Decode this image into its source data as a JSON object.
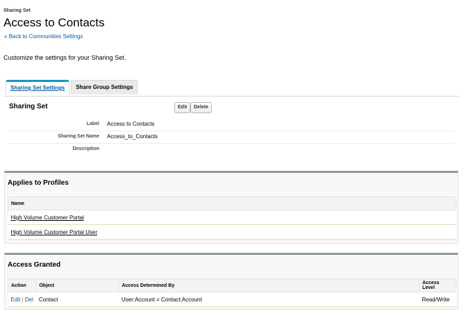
{
  "header": {
    "eyebrow": "Sharing Set",
    "title": "Access to Contacts",
    "back_prefix": "«",
    "back_link": "Back to Communities Settings",
    "intro": "Customize the settings for your Sharing Set."
  },
  "tabs": [
    {
      "label": "Sharing Set Settings",
      "active": true
    },
    {
      "label": "Share Group Settings",
      "active": false
    }
  ],
  "detail": {
    "title": "Sharing Set",
    "edit_label": "Edit",
    "delete_label": "Delete",
    "fields": [
      {
        "label": "Label",
        "value": "Access to Contacts"
      },
      {
        "label": "Sharing Set Name",
        "value": "Access_to_Contacts"
      },
      {
        "label": "Description",
        "value": ""
      }
    ]
  },
  "profiles": {
    "title": "Applies to Profiles",
    "column": "Name",
    "rows": [
      "High Volume Customer Portal",
      "High Volume Customer Portal User"
    ]
  },
  "access": {
    "title": "Access Granted",
    "columns": [
      "Action",
      "Object",
      "Access Determined By",
      "Access Level"
    ],
    "rows": [
      {
        "edit": "Edit",
        "sep": "|",
        "del": "Del",
        "object": "Contact",
        "determined_by": "User:Account = Contact:Account",
        "level": "Read/Write"
      }
    ]
  }
}
